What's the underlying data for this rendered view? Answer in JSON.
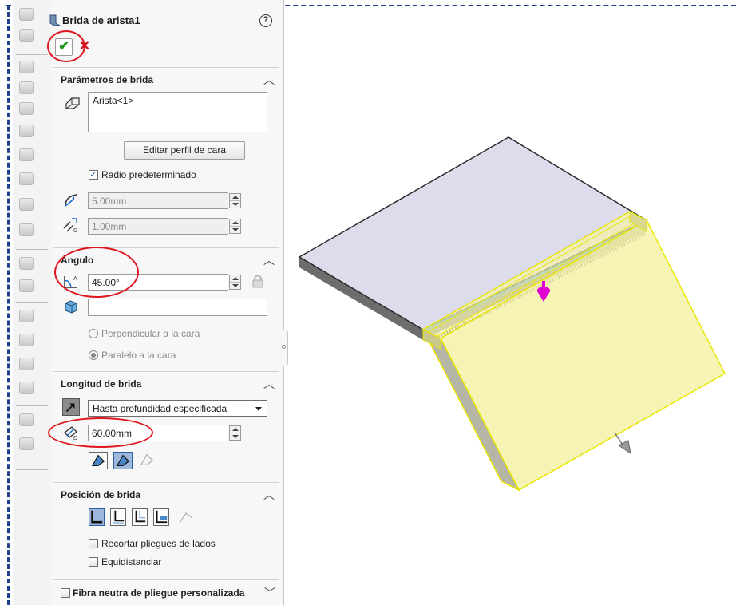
{
  "panel": {
    "title": "Brida de arista1",
    "help_icon": "help-icon",
    "ok_icon": "checkmark-icon",
    "cancel_icon": "close-icon",
    "ok_symbol": "✔",
    "cancel_symbol": "✕",
    "help_symbol": "?"
  },
  "params": {
    "title": "Parámetros de brida",
    "edges_list": [
      "Arista<1>"
    ],
    "edit_profile_label": "Editar perfil de cara",
    "default_radius_label": "Radio predeterminado",
    "default_radius_checked": true,
    "radius_value": "5.00mm",
    "thickness_value": "1.00mm"
  },
  "angle": {
    "title": "Ángulo",
    "angle_value": "45.00°",
    "reference_face_value": "",
    "perpendicular_label": "Perpendicular a la cara",
    "parallel_label": "Paralelo a la cara",
    "selected_option": "Paralelo a la cara"
  },
  "length": {
    "title": "Longitud de brida",
    "end_condition": "Hasta profundidad especificada",
    "length_value": "60.00mm"
  },
  "position": {
    "title": "Posición de brida",
    "trim_side_bends_label": "Recortar pliegues de lados",
    "trim_side_bends_checked": false,
    "offset_label": "Equidistanciar",
    "offset_checked": false
  },
  "neutral_fiber": {
    "label": "Fibra neutra de pliegue personalizada",
    "checked": false
  },
  "colors": {
    "accent_dash": "#1f3f8f",
    "highlight_ring": "#e0161e",
    "preview_yellow": "#f5f2a8",
    "preview_edge": "#e9e600",
    "selected_edge": "#3aa0e8",
    "arrow_handle": "#e000d0",
    "plate_top": "#dcdcec"
  }
}
